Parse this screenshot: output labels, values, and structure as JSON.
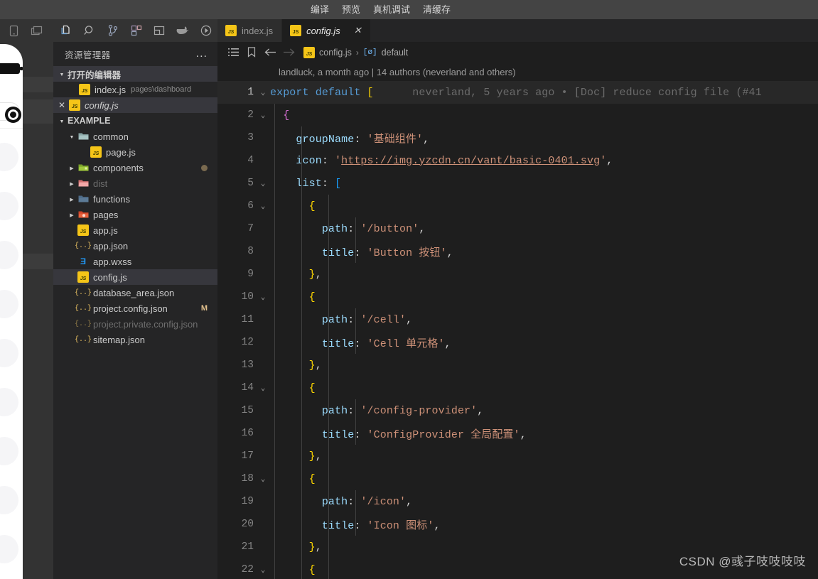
{
  "titlebar": {
    "menu": [
      {
        "label": "编译",
        "name": "menu-compile"
      },
      {
        "label": "预览",
        "name": "menu-preview"
      },
      {
        "label": "真机调试",
        "name": "menu-device-debug"
      },
      {
        "label": "清缓存",
        "name": "menu-clear-cache"
      }
    ]
  },
  "activitybar": {
    "icons": [
      {
        "name": "explorer-icon",
        "active": true
      },
      {
        "name": "search-icon",
        "active": false
      },
      {
        "name": "source-control-icon",
        "active": false
      },
      {
        "name": "extensions-icon",
        "active": false
      },
      {
        "name": "layout-split-icon",
        "active": false
      },
      {
        "name": "docker-icon",
        "active": false
      },
      {
        "name": "run-and-debug-icon",
        "active": false
      }
    ]
  },
  "sidebar": {
    "title": "资源管理器",
    "more_label": "...",
    "open_editors": {
      "label": "打开的编辑器",
      "items": [
        {
          "name": "open-editor-index-js",
          "filename": "index.js",
          "path": "pages\\dashboard",
          "icon": "js",
          "selected": false,
          "showClose": false
        },
        {
          "name": "open-editor-config-js",
          "filename": "config.js",
          "path": "",
          "icon": "js",
          "selected": true,
          "showClose": true,
          "italic": true
        }
      ]
    },
    "workspace": {
      "label": "EXAMPLE",
      "items": [
        {
          "name": "folder-common",
          "label": "common",
          "type": "folder",
          "indent": 1,
          "expanded": true,
          "color": "#8aa8a8"
        },
        {
          "name": "file-page-js",
          "label": "page.js",
          "type": "js",
          "indent": 2
        },
        {
          "name": "folder-components",
          "label": "components",
          "type": "folder",
          "indent": 1,
          "expanded": false,
          "color": "#9fc83c",
          "badge_dot": true
        },
        {
          "name": "folder-dist",
          "label": "dist",
          "type": "folder",
          "indent": 1,
          "expanded": false,
          "color": "#e88b8b",
          "dim": true
        },
        {
          "name": "folder-functions",
          "label": "functions",
          "type": "folder",
          "indent": 1,
          "expanded": false,
          "color": "#5c7a96"
        },
        {
          "name": "folder-pages",
          "label": "pages",
          "type": "folder",
          "indent": 1,
          "expanded": false,
          "color": "#e8623c"
        },
        {
          "name": "file-app-js",
          "label": "app.js",
          "type": "js",
          "indent": 1
        },
        {
          "name": "file-app-json",
          "label": "app.json",
          "type": "json",
          "indent": 1
        },
        {
          "name": "file-app-wxss",
          "label": "app.wxss",
          "type": "wxss",
          "indent": 1
        },
        {
          "name": "file-config-js",
          "label": "config.js",
          "type": "js",
          "indent": 1,
          "selected": true
        },
        {
          "name": "file-database-area-json",
          "label": "database_area.json",
          "type": "json",
          "indent": 1
        },
        {
          "name": "file-project-config-json",
          "label": "project.config.json",
          "type": "json",
          "indent": 1,
          "badge": "M"
        },
        {
          "name": "file-project-private-config-json",
          "label": "project.private.config.json",
          "type": "json",
          "indent": 1,
          "dim": true
        },
        {
          "name": "file-sitemap-json",
          "label": "sitemap.json",
          "type": "json",
          "indent": 1
        }
      ]
    }
  },
  "editor": {
    "tabs": [
      {
        "name": "tab-index-js",
        "label": "index.js",
        "icon": "js",
        "active": false,
        "closable": false
      },
      {
        "name": "tab-config-js",
        "label": "config.js",
        "icon": "js",
        "active": true,
        "closable": true,
        "close_label": "✕"
      }
    ],
    "breadcrumb": {
      "file": "config.js",
      "separator": "›",
      "symbol_icon": "[ø]",
      "symbol": "default"
    },
    "blame_header": "landluck, a month ago | 14 authors (neverland and others)",
    "inline_blame": "neverland, 5 years ago • [Doc] reduce config file (#41",
    "lines": [
      {
        "num": 1,
        "fold": true,
        "current": true,
        "guides": 0,
        "tokens": [
          {
            "t": "export ",
            "c": "kw"
          },
          {
            "t": "default",
            "c": "kw"
          },
          {
            "t": " ",
            "c": "pun"
          },
          {
            "t": "[",
            "c": "br1"
          }
        ]
      },
      {
        "num": 2,
        "fold": true,
        "current": false,
        "guides": 1,
        "tokens": [
          {
            "t": "  ",
            "c": "pun"
          },
          {
            "t": "{",
            "c": "br2"
          }
        ]
      },
      {
        "num": 3,
        "fold": false,
        "current": false,
        "guides": 2,
        "tokens": [
          {
            "t": "    ",
            "c": "pun"
          },
          {
            "t": "groupName",
            "c": "id"
          },
          {
            "t": ": ",
            "c": "pun"
          },
          {
            "t": "'基础组件'",
            "c": "str"
          },
          {
            "t": ",",
            "c": "pun"
          }
        ]
      },
      {
        "num": 4,
        "fold": false,
        "current": false,
        "guides": 2,
        "tokens": [
          {
            "t": "    ",
            "c": "pun"
          },
          {
            "t": "icon",
            "c": "id"
          },
          {
            "t": ": ",
            "c": "pun"
          },
          {
            "t": "'",
            "c": "str"
          },
          {
            "t": "https://img.yzcdn.cn/vant/basic-0401.svg",
            "c": "lnk"
          },
          {
            "t": "'",
            "c": "str"
          },
          {
            "t": ",",
            "c": "pun"
          }
        ]
      },
      {
        "num": 5,
        "fold": true,
        "current": false,
        "guides": 2,
        "tokens": [
          {
            "t": "    ",
            "c": "pun"
          },
          {
            "t": "list",
            "c": "id"
          },
          {
            "t": ": ",
            "c": "pun"
          },
          {
            "t": "[",
            "c": "br3"
          }
        ]
      },
      {
        "num": 6,
        "fold": true,
        "current": false,
        "guides": 3,
        "tokens": [
          {
            "t": "      ",
            "c": "pun"
          },
          {
            "t": "{",
            "c": "br1"
          }
        ]
      },
      {
        "num": 7,
        "fold": false,
        "current": false,
        "guides": 4,
        "tokens": [
          {
            "t": "        ",
            "c": "pun"
          },
          {
            "t": "path",
            "c": "id"
          },
          {
            "t": ": ",
            "c": "pun"
          },
          {
            "t": "'/button'",
            "c": "str"
          },
          {
            "t": ",",
            "c": "pun"
          }
        ]
      },
      {
        "num": 8,
        "fold": false,
        "current": false,
        "guides": 4,
        "tokens": [
          {
            "t": "        ",
            "c": "pun"
          },
          {
            "t": "title",
            "c": "id"
          },
          {
            "t": ": ",
            "c": "pun"
          },
          {
            "t": "'Button 按钮'",
            "c": "str"
          },
          {
            "t": ",",
            "c": "pun"
          }
        ]
      },
      {
        "num": 9,
        "fold": false,
        "current": false,
        "guides": 3,
        "tokens": [
          {
            "t": "      ",
            "c": "pun"
          },
          {
            "t": "}",
            "c": "br1"
          },
          {
            "t": ",",
            "c": "pun"
          }
        ]
      },
      {
        "num": 10,
        "fold": true,
        "current": false,
        "guides": 3,
        "tokens": [
          {
            "t": "      ",
            "c": "pun"
          },
          {
            "t": "{",
            "c": "br1"
          }
        ]
      },
      {
        "num": 11,
        "fold": false,
        "current": false,
        "guides": 4,
        "tokens": [
          {
            "t": "        ",
            "c": "pun"
          },
          {
            "t": "path",
            "c": "id"
          },
          {
            "t": ": ",
            "c": "pun"
          },
          {
            "t": "'/cell'",
            "c": "str"
          },
          {
            "t": ",",
            "c": "pun"
          }
        ]
      },
      {
        "num": 12,
        "fold": false,
        "current": false,
        "guides": 4,
        "tokens": [
          {
            "t": "        ",
            "c": "pun"
          },
          {
            "t": "title",
            "c": "id"
          },
          {
            "t": ": ",
            "c": "pun"
          },
          {
            "t": "'Cell 单元格'",
            "c": "str"
          },
          {
            "t": ",",
            "c": "pun"
          }
        ]
      },
      {
        "num": 13,
        "fold": false,
        "current": false,
        "guides": 3,
        "tokens": [
          {
            "t": "      ",
            "c": "pun"
          },
          {
            "t": "}",
            "c": "br1"
          },
          {
            "t": ",",
            "c": "pun"
          }
        ]
      },
      {
        "num": 14,
        "fold": true,
        "current": false,
        "guides": 3,
        "tokens": [
          {
            "t": "      ",
            "c": "pun"
          },
          {
            "t": "{",
            "c": "br1"
          }
        ]
      },
      {
        "num": 15,
        "fold": false,
        "current": false,
        "guides": 4,
        "tokens": [
          {
            "t": "        ",
            "c": "pun"
          },
          {
            "t": "path",
            "c": "id"
          },
          {
            "t": ": ",
            "c": "pun"
          },
          {
            "t": "'/config-provider'",
            "c": "str"
          },
          {
            "t": ",",
            "c": "pun"
          }
        ]
      },
      {
        "num": 16,
        "fold": false,
        "current": false,
        "guides": 4,
        "tokens": [
          {
            "t": "        ",
            "c": "pun"
          },
          {
            "t": "title",
            "c": "id"
          },
          {
            "t": ": ",
            "c": "pun"
          },
          {
            "t": "'ConfigProvider 全局配置'",
            "c": "str"
          },
          {
            "t": ",",
            "c": "pun"
          }
        ]
      },
      {
        "num": 17,
        "fold": false,
        "current": false,
        "guides": 3,
        "tokens": [
          {
            "t": "      ",
            "c": "pun"
          },
          {
            "t": "}",
            "c": "br1"
          },
          {
            "t": ",",
            "c": "pun"
          }
        ]
      },
      {
        "num": 18,
        "fold": true,
        "current": false,
        "guides": 3,
        "tokens": [
          {
            "t": "      ",
            "c": "pun"
          },
          {
            "t": "{",
            "c": "br1"
          }
        ]
      },
      {
        "num": 19,
        "fold": false,
        "current": false,
        "guides": 4,
        "tokens": [
          {
            "t": "        ",
            "c": "pun"
          },
          {
            "t": "path",
            "c": "id"
          },
          {
            "t": ": ",
            "c": "pun"
          },
          {
            "t": "'/icon'",
            "c": "str"
          },
          {
            "t": ",",
            "c": "pun"
          }
        ]
      },
      {
        "num": 20,
        "fold": false,
        "current": false,
        "guides": 4,
        "tokens": [
          {
            "t": "        ",
            "c": "pun"
          },
          {
            "t": "title",
            "c": "id"
          },
          {
            "t": ": ",
            "c": "pun"
          },
          {
            "t": "'Icon 图标'",
            "c": "str"
          },
          {
            "t": ",",
            "c": "pun"
          }
        ]
      },
      {
        "num": 21,
        "fold": false,
        "current": false,
        "guides": 3,
        "tokens": [
          {
            "t": "      ",
            "c": "pun"
          },
          {
            "t": "}",
            "c": "br1"
          },
          {
            "t": ",",
            "c": "pun"
          }
        ]
      },
      {
        "num": 22,
        "fold": true,
        "current": false,
        "guides": 3,
        "tokens": [
          {
            "t": "      ",
            "c": "pun"
          },
          {
            "t": "{",
            "c": "br1"
          }
        ]
      }
    ]
  },
  "watermark": "CSDN @彧子吱吱吱吱"
}
